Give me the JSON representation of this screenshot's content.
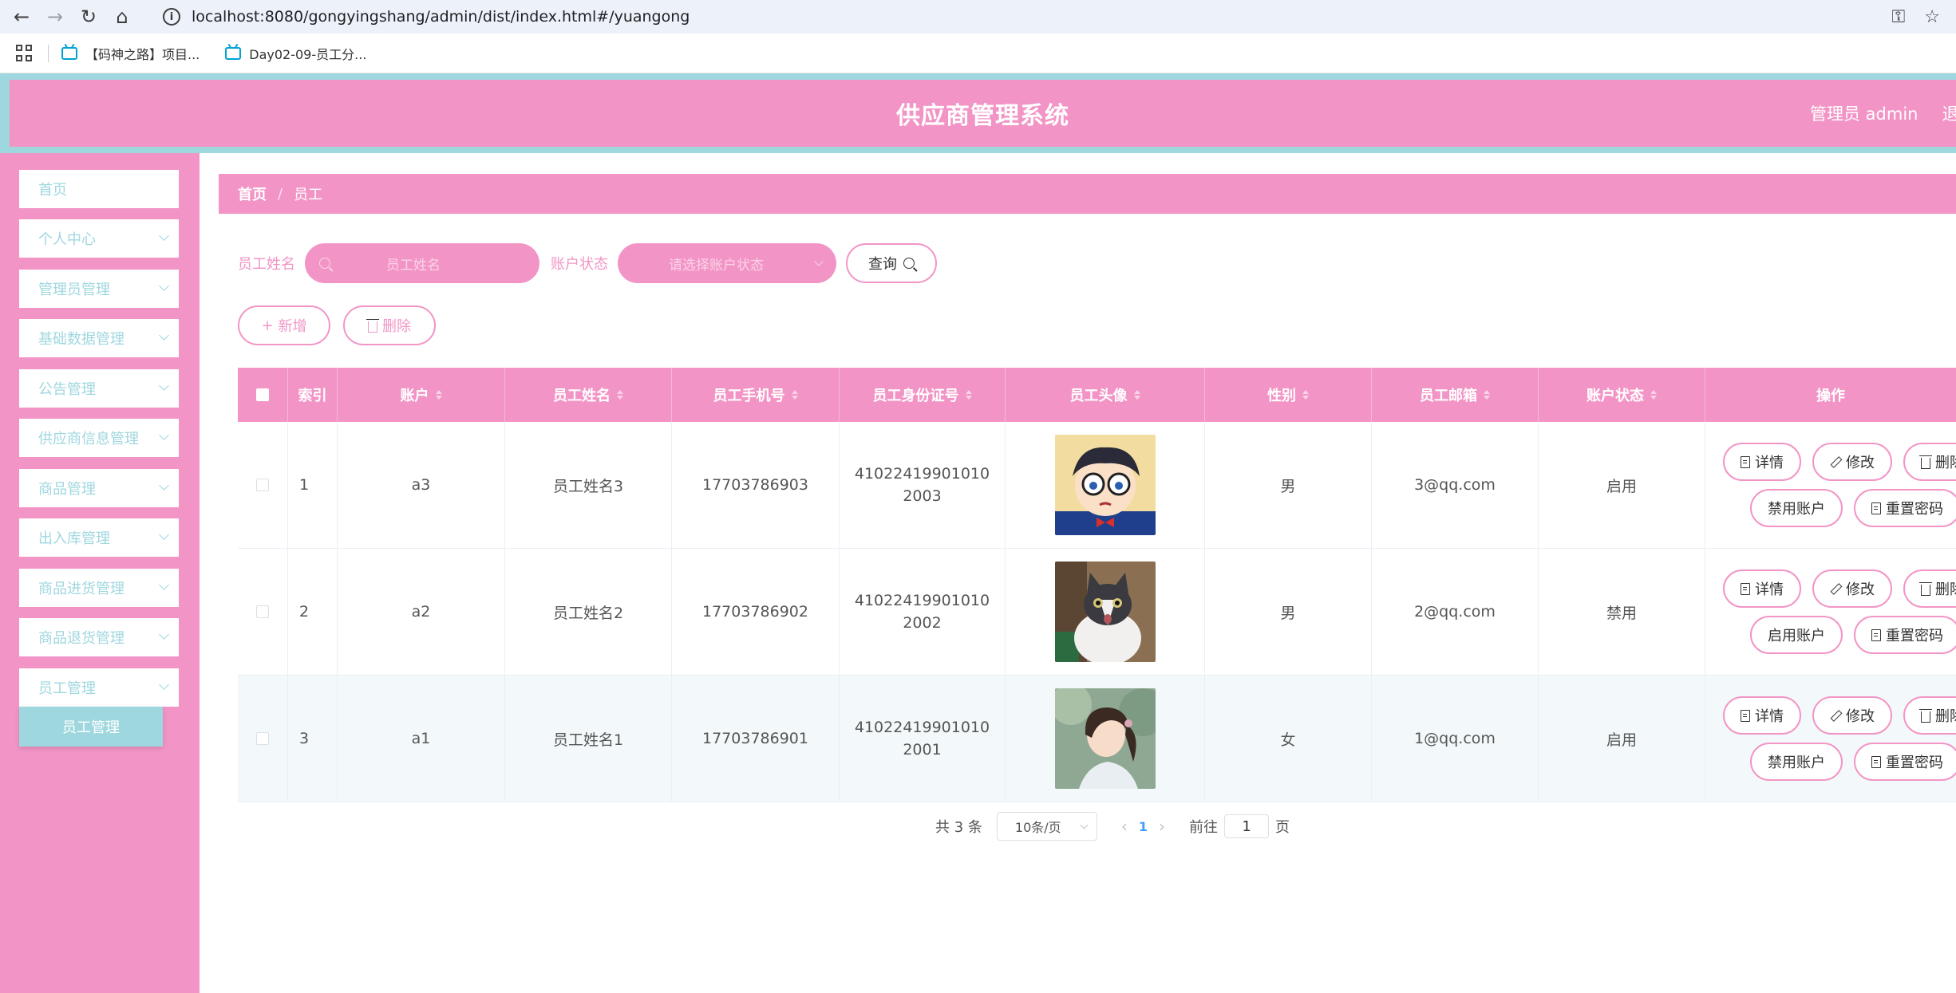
{
  "browser": {
    "url": "localhost:8080/gongyingshang/admin/dist/index.html#/yuangong",
    "bookmarks": [
      "【码神之路】项目...",
      "Day02-09-员工分..."
    ]
  },
  "header": {
    "title": "供应商管理系统",
    "user": "管理员 admin",
    "logout": "退出"
  },
  "sidebar": {
    "items": [
      "首页",
      "个人中心",
      "管理员管理",
      "基础数据管理",
      "公告管理",
      "供应商信息管理",
      "商品管理",
      "出入库管理",
      "商品进货管理",
      "商品退货管理",
      "员工管理"
    ],
    "sub_item": "员工管理"
  },
  "breadcrumb": {
    "home": "首页",
    "sep": "/",
    "current": "员工"
  },
  "search": {
    "name_label": "员工姓名",
    "name_placeholder": "员工姓名",
    "status_label": "账户状态",
    "status_placeholder": "请选择账户状态",
    "query_label": "查询"
  },
  "actions": {
    "add": "新增",
    "delete": "删除"
  },
  "table": {
    "columns": [
      "索引",
      "账户",
      "员工姓名",
      "员工手机号",
      "员工身份证号",
      "员工头像",
      "性别",
      "员工邮箱",
      "账户状态",
      "操作"
    ],
    "rows": [
      {
        "index": "1",
        "account": "a3",
        "name": "员工姓名3",
        "phone": "17703786903",
        "idcard": "410224199010102003",
        "gender": "男",
        "email": "3@qq.com",
        "status": "启用",
        "toggle": "禁用账户"
      },
      {
        "index": "2",
        "account": "a2",
        "name": "员工姓名2",
        "phone": "17703786902",
        "idcard": "410224199010102002",
        "gender": "男",
        "email": "2@qq.com",
        "status": "禁用",
        "toggle": "启用账户"
      },
      {
        "index": "3",
        "account": "a1",
        "name": "员工姓名1",
        "phone": "17703786901",
        "idcard": "410224199010102001",
        "gender": "女",
        "email": "1@qq.com",
        "status": "启用",
        "toggle": "禁用账户"
      }
    ],
    "op_labels": {
      "detail": "详情",
      "edit": "修改",
      "delete": "删除",
      "reset": "重置密码"
    }
  },
  "pagination": {
    "total": "共 3 条",
    "page_size": "10条/页",
    "current_page": "1",
    "goto_label": "前往",
    "goto_value": "1",
    "page_unit": "页"
  },
  "colors": {
    "pink": "#f295c6",
    "teal": "#9fd7df"
  }
}
